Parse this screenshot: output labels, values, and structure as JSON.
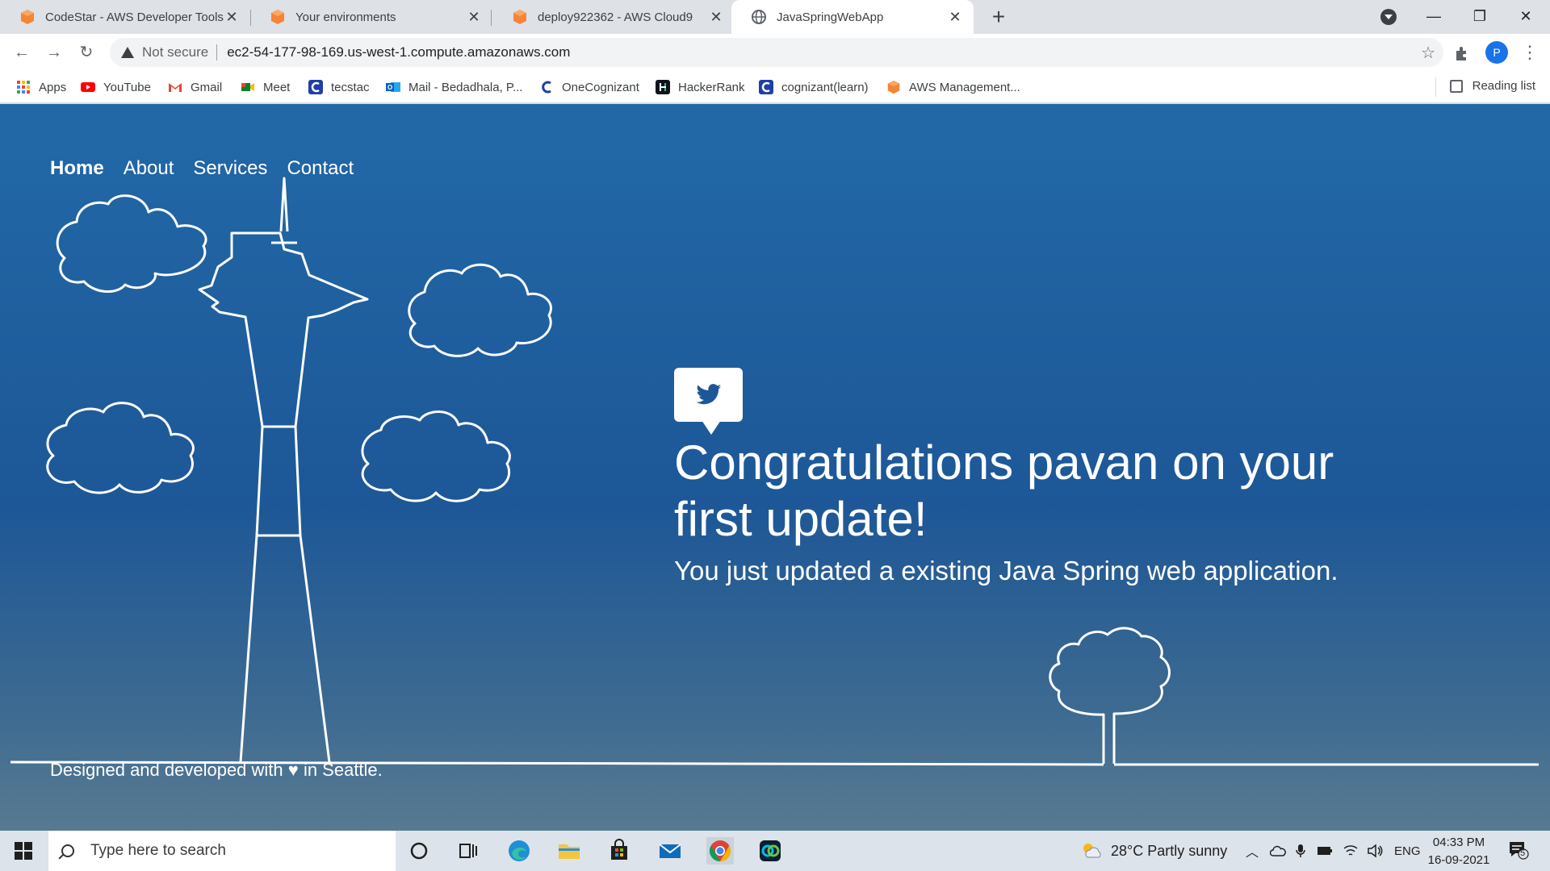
{
  "browser": {
    "tabs": [
      {
        "title": "CodeStar - AWS Developer Tools",
        "icon": "aws-cube-icon",
        "active": false
      },
      {
        "title": "Your environments",
        "icon": "aws-cube-icon",
        "active": false
      },
      {
        "title": "deploy922362 - AWS Cloud9",
        "icon": "aws-cube-icon",
        "active": false
      },
      {
        "title": "JavaSpringWebApp",
        "icon": "globe-icon",
        "active": true
      }
    ],
    "address": {
      "security_label": "Not secure",
      "url": "ec2-54-177-98-169.us-west-1.compute.amazonaws.com"
    },
    "profile_initial": "P",
    "bookmarks": [
      {
        "label": "Apps",
        "icon": "apps-grid-icon"
      },
      {
        "label": "YouTube",
        "icon": "youtube-icon"
      },
      {
        "label": "Gmail",
        "icon": "gmail-icon"
      },
      {
        "label": "Meet",
        "icon": "meet-icon"
      },
      {
        "label": "tecstac",
        "icon": "c-logo-icon"
      },
      {
        "label": "Mail - Bedadhala, P...",
        "icon": "outlook-icon"
      },
      {
        "label": "OneCognizant",
        "icon": "c-logo-icon"
      },
      {
        "label": "HackerRank",
        "icon": "hackerrank-icon"
      },
      {
        "label": "cognizant(learn)",
        "icon": "c-logo-icon"
      },
      {
        "label": "AWS Management...",
        "icon": "aws-cube-icon"
      }
    ],
    "reading_list": "Reading list"
  },
  "page": {
    "nav": {
      "home": "Home",
      "about": "About",
      "services": "Services",
      "contact": "Contact"
    },
    "headline": "Congratulations pavan on your first update!",
    "subline": "You just updated a existing Java Spring web application.",
    "footer": "Designed and developed with ♥ in Seattle."
  },
  "taskbar": {
    "search_placeholder": "Type here to search",
    "weather": "28°C  Partly sunny",
    "language": "ENG",
    "time": "04:33 PM",
    "date": "16-09-2021",
    "notification_count": "5"
  },
  "colors": {
    "page_gradient_top": "#2269a8",
    "page_gradient_bottom": "#587a91",
    "aws_orange": "#f58536",
    "chrome_blue": "#1a73e8"
  }
}
